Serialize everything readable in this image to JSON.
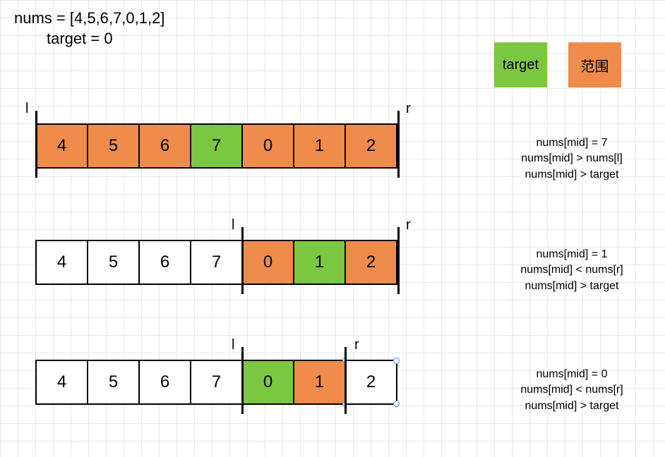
{
  "header": {
    "line1": "nums = [4,5,6,7,0,1,2]",
    "line2": "target = 0"
  },
  "legend": {
    "target_label": "target",
    "range_label": "范围"
  },
  "rows": [
    {
      "cells": [
        {
          "v": "4",
          "c": "orange"
        },
        {
          "v": "5",
          "c": "orange"
        },
        {
          "v": "6",
          "c": "orange"
        },
        {
          "v": "7",
          "c": "green"
        },
        {
          "v": "0",
          "c": "orange"
        },
        {
          "v": "1",
          "c": "orange"
        },
        {
          "v": "2",
          "c": "orange"
        }
      ],
      "l_idx": 0,
      "r_idx": 7,
      "l_label": "l",
      "r_label": "r",
      "notes": [
        "nums[mid] = 7",
        "nums[mid] > nums[l]",
        "nums[mid] > target"
      ]
    },
    {
      "cells": [
        {
          "v": "4",
          "c": ""
        },
        {
          "v": "5",
          "c": ""
        },
        {
          "v": "6",
          "c": ""
        },
        {
          "v": "7",
          "c": ""
        },
        {
          "v": "0",
          "c": "orange"
        },
        {
          "v": "1",
          "c": "green"
        },
        {
          "v": "2",
          "c": "orange"
        }
      ],
      "l_idx": 4,
      "r_idx": 7,
      "l_label": "l",
      "r_label": "r",
      "notes": [
        "nums[mid] = 1",
        "nums[mid] < nums[r]",
        "nums[mid] > target"
      ]
    },
    {
      "cells": [
        {
          "v": "4",
          "c": ""
        },
        {
          "v": "5",
          "c": ""
        },
        {
          "v": "6",
          "c": ""
        },
        {
          "v": "7",
          "c": ""
        },
        {
          "v": "0",
          "c": "green"
        },
        {
          "v": "1",
          "c": "orange"
        },
        {
          "v": "2",
          "c": "",
          "sel": true
        }
      ],
      "l_idx": 4,
      "r_idx": 6,
      "l_label": "l",
      "r_label": "r",
      "notes": [
        "nums[mid] = 0",
        "nums[mid] < nums[r]",
        "nums[mid] > target"
      ]
    }
  ]
}
